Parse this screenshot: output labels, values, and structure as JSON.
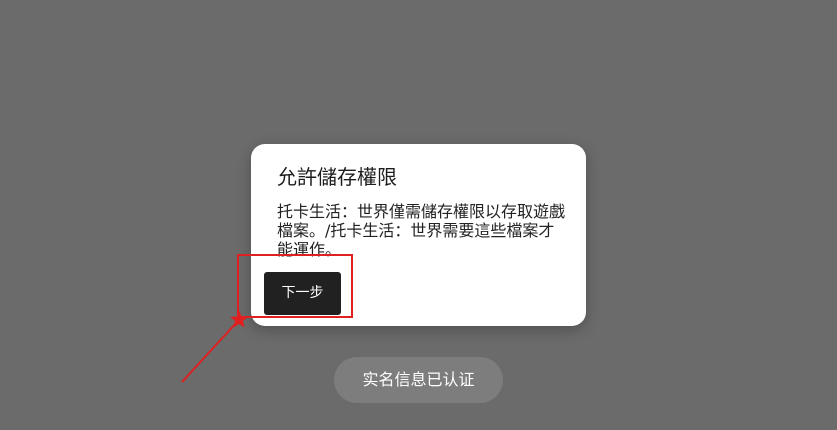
{
  "dialog": {
    "title": "允許儲存權限",
    "message": "托卡生活：世界僅需儲存權限以存取遊戲檔案。/托卡生活：世界需要這些檔案才能運作。",
    "next_button_label": "下一步"
  },
  "toast": {
    "text": "实名信息已认证"
  },
  "colors": {
    "backdrop": "#6b6b6b",
    "dialog_bg": "#ffffff",
    "button_bg": "#212121",
    "annotation": "#e02020",
    "toast_bg": "#7d7d7d"
  },
  "annotation": {
    "target": "next-button",
    "marker_icon": "star-icon"
  }
}
